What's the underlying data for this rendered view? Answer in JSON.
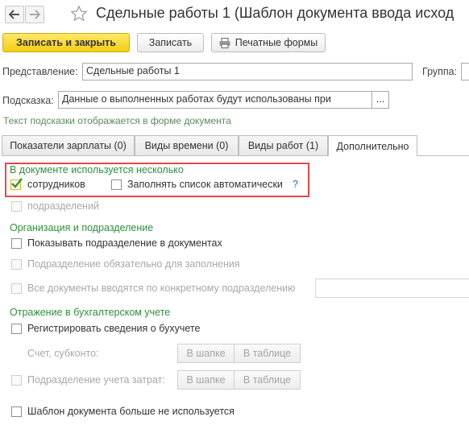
{
  "header": {
    "back_icon": "arrow-left-icon",
    "forward_icon": "arrow-right-icon",
    "favorite_icon": "star-icon",
    "title": "Сдельные работы 1 (Шаблон документа ввода исход"
  },
  "toolbar": {
    "save_close_label": "Записать и закрыть",
    "save_label": "Записать",
    "print_label": "Печатные формы",
    "print_icon": "printer-icon"
  },
  "form": {
    "representation_label": "Представление:",
    "representation_value": "Сдельные работы 1",
    "group_label": "Группа:",
    "hint_label": "Подсказка:",
    "hint_value": "Данные о выполненных работах будут использованы при",
    "hint_button": "...",
    "hint_note": "Текст подсказки отображается в форме документа"
  },
  "tabs": [
    {
      "label": "Показатели зарплаты (0)"
    },
    {
      "label": "Виды времени (0)"
    },
    {
      "label": "Виды работ (1)"
    },
    {
      "label": "Дополнительно"
    }
  ],
  "additional": {
    "multiple_section": "В документе используется несколько",
    "employees_label": "сотрудников",
    "employees_checked": true,
    "autofill_label": "Заполнять список автоматически",
    "autofill_checked": false,
    "help_label": "?",
    "departments_label": "подразделений",
    "org_section": "Организация и подразделение",
    "show_dept_label": "Показывать подразделение в документах",
    "dept_required_label": "Подразделение обязательно для заполнения",
    "all_docs_label": "Все документы вводятся по конкретному подразделению",
    "accounting_section": "Отражение в бухгалтерском учете",
    "register_label": "Регистрировать сведения о бухучете",
    "account_label": "Счет, субконто:",
    "cost_dept_label": "Подразделение учета затрат:",
    "in_header": "В шапке",
    "in_table": "В таблице",
    "not_used_label": "Шаблон документа больше не используется"
  }
}
